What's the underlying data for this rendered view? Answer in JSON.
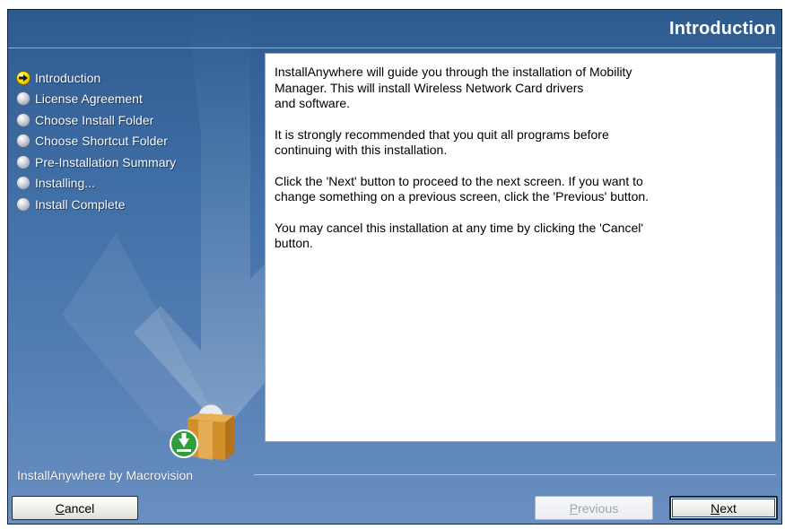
{
  "window": {
    "title": "Introduction"
  },
  "steps": [
    {
      "label": "Introduction",
      "state": "current"
    },
    {
      "label": "License Agreement",
      "state": "pending"
    },
    {
      "label": "Choose Install Folder",
      "state": "pending"
    },
    {
      "label": "Choose Shortcut Folder",
      "state": "pending"
    },
    {
      "label": "Pre-Installation Summary",
      "state": "pending"
    },
    {
      "label": "Installing...",
      "state": "pending"
    },
    {
      "label": "Install Complete",
      "state": "pending"
    }
  ],
  "content": {
    "paragraphs": [
      "InstallAnywhere will guide you through the installation of Mobility\nManager. This will install Wireless Network Card drivers\nand software.",
      "It is strongly recommended that you quit all programs before\ncontinuing with this installation.",
      "Click the 'Next' button to proceed to the next screen. If you want to\nchange something on a previous screen, click the 'Previous' button.",
      "You may cancel this installation at any time by clicking the 'Cancel'\nbutton."
    ]
  },
  "footer": {
    "brand": "InstallAnywhere by Macrovision"
  },
  "buttons": {
    "cancel": {
      "mnemonic": "C",
      "rest": "ancel",
      "enabled": true
    },
    "previous": {
      "mnemonic": "P",
      "rest": "revious",
      "enabled": false
    },
    "next": {
      "mnemonic": "N",
      "rest": "ext",
      "enabled": true
    }
  },
  "icons": {
    "current_step": "arrow-right-icon",
    "pending_step": "circle-bullet-icon",
    "product": "install-box-icon"
  },
  "colors": {
    "panel_top": "#2f5a8e",
    "panel_bottom": "#6a8fc0",
    "current_bullet": "#ffe000"
  }
}
